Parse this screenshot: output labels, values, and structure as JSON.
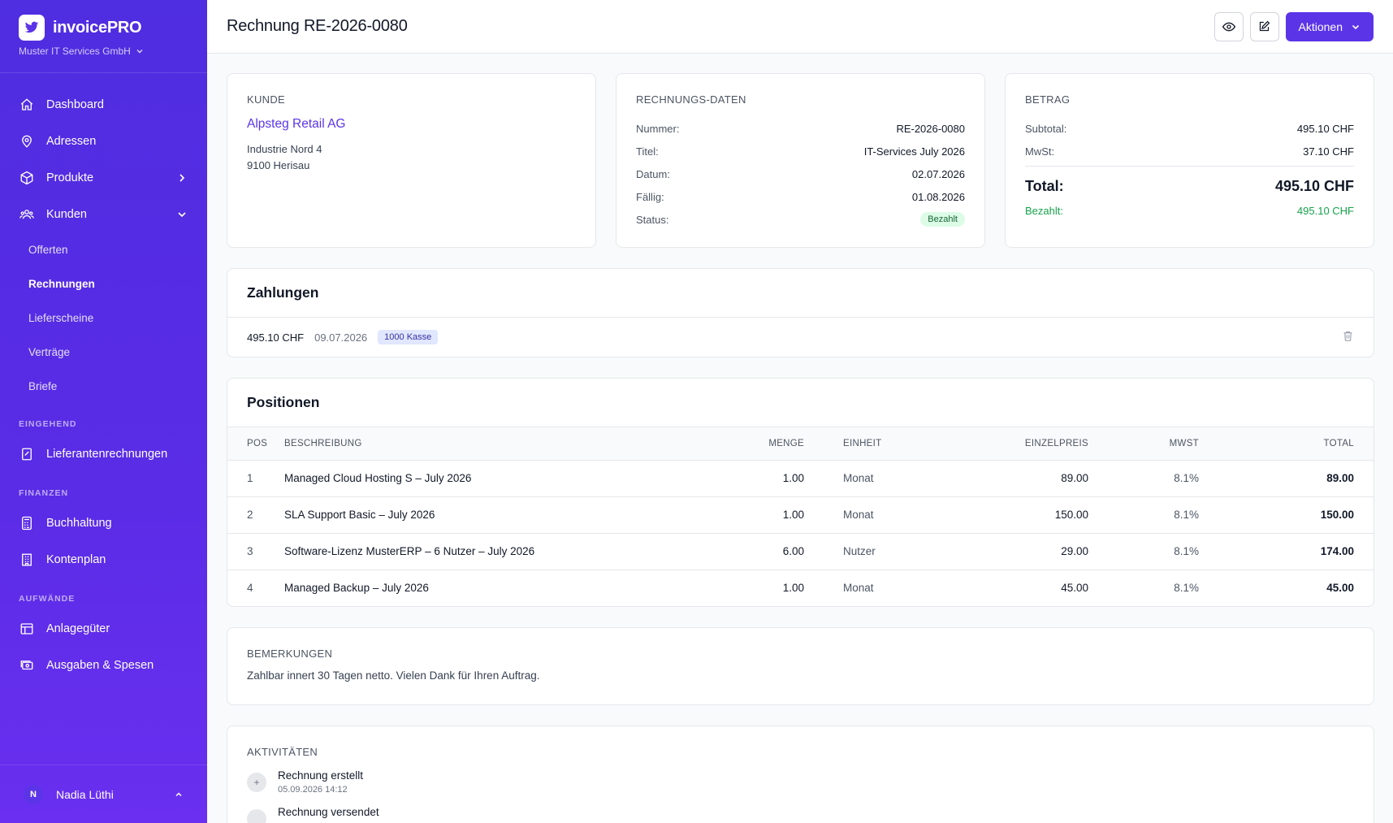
{
  "sidebar": {
    "brand": "invoicePRO",
    "company": "Muster IT Services GmbH",
    "items": [
      {
        "label": "Dashboard"
      },
      {
        "label": "Adressen"
      },
      {
        "label": "Produkte"
      },
      {
        "label": "Kunden"
      }
    ],
    "sub_items": [
      {
        "label": "Offerten"
      },
      {
        "label": "Rechnungen"
      },
      {
        "label": "Lieferscheine"
      },
      {
        "label": "Verträge"
      },
      {
        "label": "Briefe"
      }
    ],
    "sections": [
      {
        "label": "EINGEHEND",
        "items": [
          {
            "label": "Lieferantenrechnungen"
          }
        ]
      },
      {
        "label": "FINANZEN",
        "items": [
          {
            "label": "Buchhaltung"
          },
          {
            "label": "Kontenplan"
          }
        ]
      },
      {
        "label": "AUFWÄNDE",
        "items": [
          {
            "label": "Anlagegüter"
          },
          {
            "label": "Ausgaben & Spesen"
          }
        ]
      }
    ],
    "user": {
      "initial": "N",
      "name": "Nadia Lüthi"
    }
  },
  "header": {
    "title": "Rechnung RE-2026-0080",
    "actions_label": "Aktionen"
  },
  "customer": {
    "label": "KUNDE",
    "name": "Alpsteg Retail AG",
    "street": "Industrie Nord 4",
    "city": "9100 Herisau"
  },
  "invoice_data": {
    "label": "RECHNUNGS-DATEN",
    "rows": [
      {
        "key": "Nummer:",
        "value": "RE-2026-0080"
      },
      {
        "key": "Titel:",
        "value": "IT-Services July 2026"
      },
      {
        "key": "Datum:",
        "value": "02.07.2026"
      },
      {
        "key": "Fällig:",
        "value": "01.08.2026"
      }
    ],
    "status_key": "Status:",
    "status_value": "Bezahlt",
    "status_color": "#166534"
  },
  "amount": {
    "label": "BETRAG",
    "subtotal_key": "Subtotal:",
    "subtotal": "495.10 CHF",
    "vat_key": "MwSt:",
    "vat": "37.10 CHF",
    "total_key": "Total:",
    "total": "495.10 CHF",
    "paid_key": "Bezahlt:",
    "paid": "495.10 CHF",
    "paid_color": "#16a34a"
  },
  "payments": {
    "title": "Zahlungen",
    "items": [
      {
        "amount": "495.10 CHF",
        "date": "09.07.2026",
        "account": "1000 Kasse"
      }
    ]
  },
  "positions": {
    "title": "Positionen",
    "columns": [
      "POS",
      "BESCHREIBUNG",
      "MENGE",
      "EINHEIT",
      "EINZELPREIS",
      "MWST",
      "TOTAL"
    ],
    "rows": [
      {
        "pos": "1",
        "desc": "Managed Cloud Hosting S – July 2026",
        "qty": "1.00",
        "unit": "Monat",
        "price": "89.00",
        "vat": "8.1%",
        "total": "89.00"
      },
      {
        "pos": "2",
        "desc": "SLA Support Basic – July 2026",
        "qty": "1.00",
        "unit": "Monat",
        "price": "150.00",
        "vat": "8.1%",
        "total": "150.00"
      },
      {
        "pos": "3",
        "desc": "Software-Lizenz MusterERP – 6 Nutzer – July 2026",
        "qty": "6.00",
        "unit": "Nutzer",
        "price": "29.00",
        "vat": "8.1%",
        "total": "174.00"
      },
      {
        "pos": "4",
        "desc": "Managed Backup – July 2026",
        "qty": "1.00",
        "unit": "Monat",
        "price": "45.00",
        "vat": "8.1%",
        "total": "45.00"
      }
    ]
  },
  "remarks": {
    "label": "BEMERKUNGEN",
    "text": "Zahlbar innert 30 Tagen netto. Vielen Dank für Ihren Auftrag."
  },
  "activities": {
    "label": "AKTIVITÄTEN",
    "items": [
      {
        "icon": "+",
        "title": "Rechnung erstellt",
        "time": "05.09.2026 14:12"
      },
      {
        "icon": "",
        "title": "Rechnung versendet",
        "time": ""
      }
    ]
  },
  "colors": {
    "accent": "#5b34e8",
    "sidebar": "#4f2de0",
    "paid": "#16a34a"
  }
}
